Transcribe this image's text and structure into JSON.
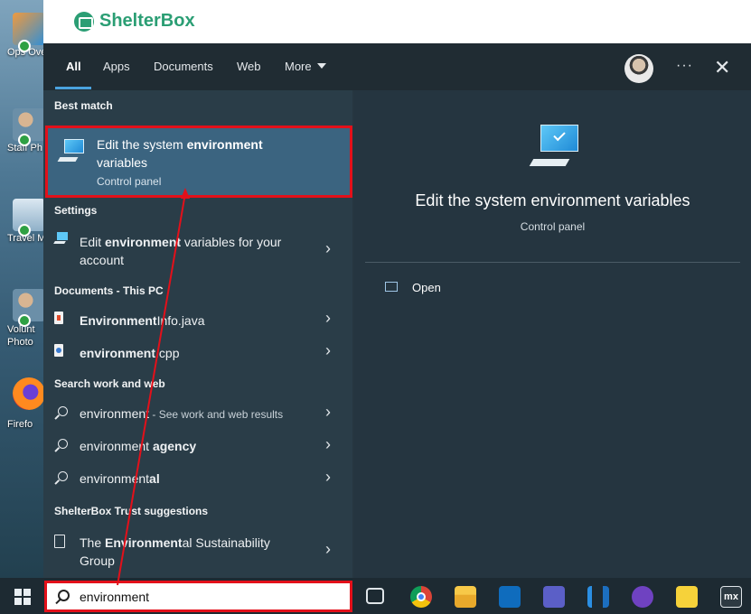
{
  "desktop": {
    "icons": [
      {
        "label": "Ops Overvi",
        "icon": "shortcut-icon"
      },
      {
        "label": "Staff Ph",
        "icon": "people-icon"
      },
      {
        "label": "Travel M",
        "icon": "travel-icon"
      },
      {
        "label": "Volunt Photo",
        "icon": "people-icon"
      },
      {
        "label": "Firefo",
        "icon": "firefox-icon"
      }
    ]
  },
  "brand": {
    "name": "ShelterBox"
  },
  "search": {
    "tabs": [
      "All",
      "Apps",
      "Documents",
      "Web",
      "More"
    ],
    "active_tab": "All",
    "best_match": {
      "section": "Best match",
      "title_pre": "Edit the system ",
      "title_bold": "environment",
      "title_post": "variables",
      "subtitle": "Control panel"
    },
    "settings": {
      "section": "Settings",
      "item_pre": "Edit ",
      "item_bold": "environment",
      "item_post": " variables for your",
      "item_line2": "account"
    },
    "documents": {
      "section": "Documents - This PC",
      "items": [
        {
          "bold": "Environment",
          "rest": "Info.java"
        },
        {
          "bold": "environment",
          "rest": ".cpp"
        }
      ]
    },
    "web": {
      "section": "Search work and web",
      "items": [
        {
          "pre": "environment",
          "bold": "",
          "hint": " - See work and web results"
        },
        {
          "pre": "environment ",
          "bold": "agency",
          "hint": ""
        },
        {
          "pre": "environment",
          "bold": "al",
          "hint": ""
        }
      ]
    },
    "suggestions": {
      "section": "ShelterBox Trust suggestions",
      "pre": "The ",
      "bold": "Environment",
      "post": "al Sustainability",
      "line2": "Group"
    },
    "preview": {
      "title": "Edit the system environment variables",
      "subtitle": "Control panel",
      "open_label": "Open"
    },
    "query": "environment"
  },
  "taskbar": {
    "apps": [
      "task-view-icon",
      "chrome-icon",
      "file-explorer-icon",
      "outlook-icon",
      "teams-icon",
      "vscode-icon",
      "github-icon",
      "sticky-notes-icon",
      "mx-icon"
    ],
    "mx_label": "mx"
  },
  "colors": {
    "brand": "#2b9e74",
    "highlight": "#e3101a",
    "accent": "#4aa3df",
    "selected_row": "#3b6480"
  }
}
